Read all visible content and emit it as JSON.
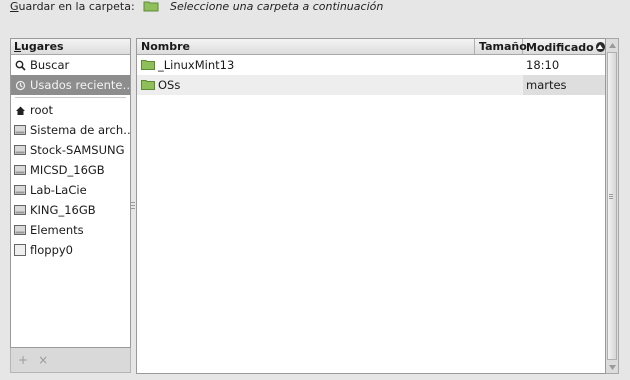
{
  "dialog": {
    "save_in_label_prefix": "G",
    "save_in_label_rest": "uardar en la carpeta:",
    "folder_hint": "Seleccione una carpeta a continuación"
  },
  "places": {
    "header_prefix": "L",
    "header_rest": "ugares",
    "items": [
      {
        "label": "Buscar",
        "icon": "search-icon"
      },
      {
        "label": "Usados reciente…",
        "icon": "recent-icon",
        "selected": true
      },
      {
        "label": "root",
        "icon": "home-icon"
      },
      {
        "label": "Sistema de arch…",
        "icon": "drive-icon"
      },
      {
        "label": "Stock-SAMSUNG",
        "icon": "drive-icon"
      },
      {
        "label": "MICSD_16GB",
        "icon": "drive-icon"
      },
      {
        "label": "Lab-LaCie",
        "icon": "drive-icon"
      },
      {
        "label": "KING_16GB",
        "icon": "drive-icon"
      },
      {
        "label": "Elements",
        "icon": "drive-icon"
      },
      {
        "label": "floppy0",
        "icon": "floppy-icon"
      }
    ],
    "footer": {
      "add": "+",
      "remove": "×"
    }
  },
  "files": {
    "columns": {
      "name": "Nombre",
      "size": "Tamaño",
      "modified": "Modificado"
    },
    "rows": [
      {
        "name": "_LinuxMint13",
        "size": "",
        "modified": "18:10",
        "icon": "folder-icon"
      },
      {
        "name": "OSs",
        "size": "",
        "modified": "martes",
        "icon": "folder-icon"
      }
    ]
  },
  "colors": {
    "folder": "#8fbf5a",
    "selected": "#8d8d8d"
  }
}
